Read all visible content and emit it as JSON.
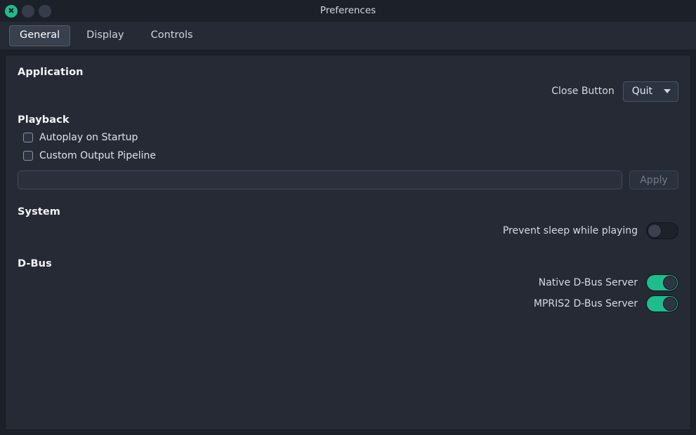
{
  "window": {
    "title": "Preferences",
    "buttons": [
      {
        "name": "close",
        "icon": "close-icon",
        "glyph": "✖",
        "color": "#1dbd8c"
      },
      {
        "name": "minimize",
        "icon": "minimize-icon",
        "glyph": "",
        "color": "#363c49"
      },
      {
        "name": "maximize",
        "icon": "maximize-icon",
        "glyph": "",
        "color": "#363c49"
      }
    ]
  },
  "tabs": [
    {
      "label": "General",
      "active": true
    },
    {
      "label": "Display",
      "active": false
    },
    {
      "label": "Controls",
      "active": false
    }
  ],
  "sections": {
    "application": {
      "title": "Application",
      "close_button_label": "Close Button",
      "close_button_value": "Quit",
      "close_button_options": [
        "Quit"
      ]
    },
    "playback": {
      "title": "Playback",
      "autoplay_label": "Autoplay on Startup",
      "autoplay_checked": false,
      "custom_pipeline_label": "Custom Output Pipeline",
      "custom_pipeline_checked": false,
      "pipeline_value": "",
      "pipeline_placeholder": "",
      "apply_label": "Apply",
      "apply_enabled": false
    },
    "system": {
      "title": "System",
      "prevent_sleep_label": "Prevent sleep while playing",
      "prevent_sleep_on": false
    },
    "dbus": {
      "title": "D-Bus",
      "native_label": "Native D-Bus Server",
      "native_on": true,
      "mpris2_label": "MPRIS2 D-Bus Server",
      "mpris2_on": true
    }
  },
  "colors": {
    "accent": "#1dbd8c",
    "window_bg": "#1c2029",
    "tabbar_bg": "#252a35",
    "content_bg": "#262a35",
    "text": "#dfe3e9",
    "text_muted": "#737b89"
  }
}
